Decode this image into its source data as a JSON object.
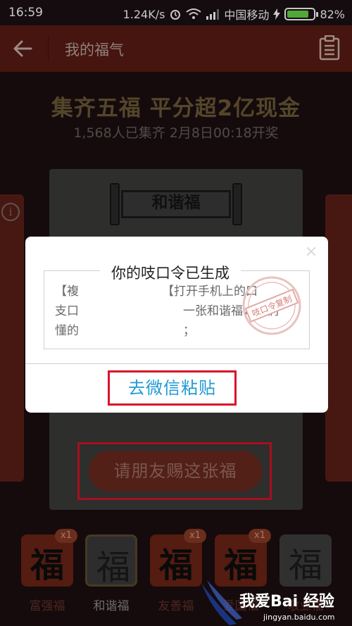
{
  "status_bar": {
    "time": "16:59",
    "speed": "1.24K/s",
    "carrier": "中国移动",
    "battery": "82%",
    "battery_level": 0.82
  },
  "header": {
    "title": "我的福气"
  },
  "main": {
    "headline": "集齐五福 平分超2亿现金",
    "subline": "1,568人已集齐 2月8日00:18开奖",
    "card_title": "和谐福",
    "gift_button": "请朋友赐这张福"
  },
  "fu_cards": [
    {
      "glyph": "福",
      "label": "富强福",
      "badge": "x1"
    },
    {
      "glyph": "福",
      "label": "和谐福",
      "badge": ""
    },
    {
      "glyph": "福",
      "label": "友善福",
      "badge": "x1"
    },
    {
      "glyph": "福",
      "label": "爱国福",
      "badge": "x1"
    },
    {
      "glyph": "福",
      "label": "敬业福",
      "badge": ""
    }
  ],
  "dialog": {
    "title": "你的吱口令已生成",
    "line1_a": "【複",
    "line1_b": "【打开手机上的口",
    "line2_a": "支口",
    "line2_b": "一张和谐福，你们",
    "line3_a": "懂的",
    "line3_b": "；",
    "stamp_text": "吱口令复制",
    "paste_button": "去微信粘贴"
  },
  "watermark": {
    "text": "我爱Bai 经验",
    "url": "jingyan.baidu.com"
  },
  "colors": {
    "accent_red": "#d8142a",
    "link_blue": "#1f9ad4",
    "gold": "#6c5a36",
    "app_bar": "#5a1c14"
  }
}
